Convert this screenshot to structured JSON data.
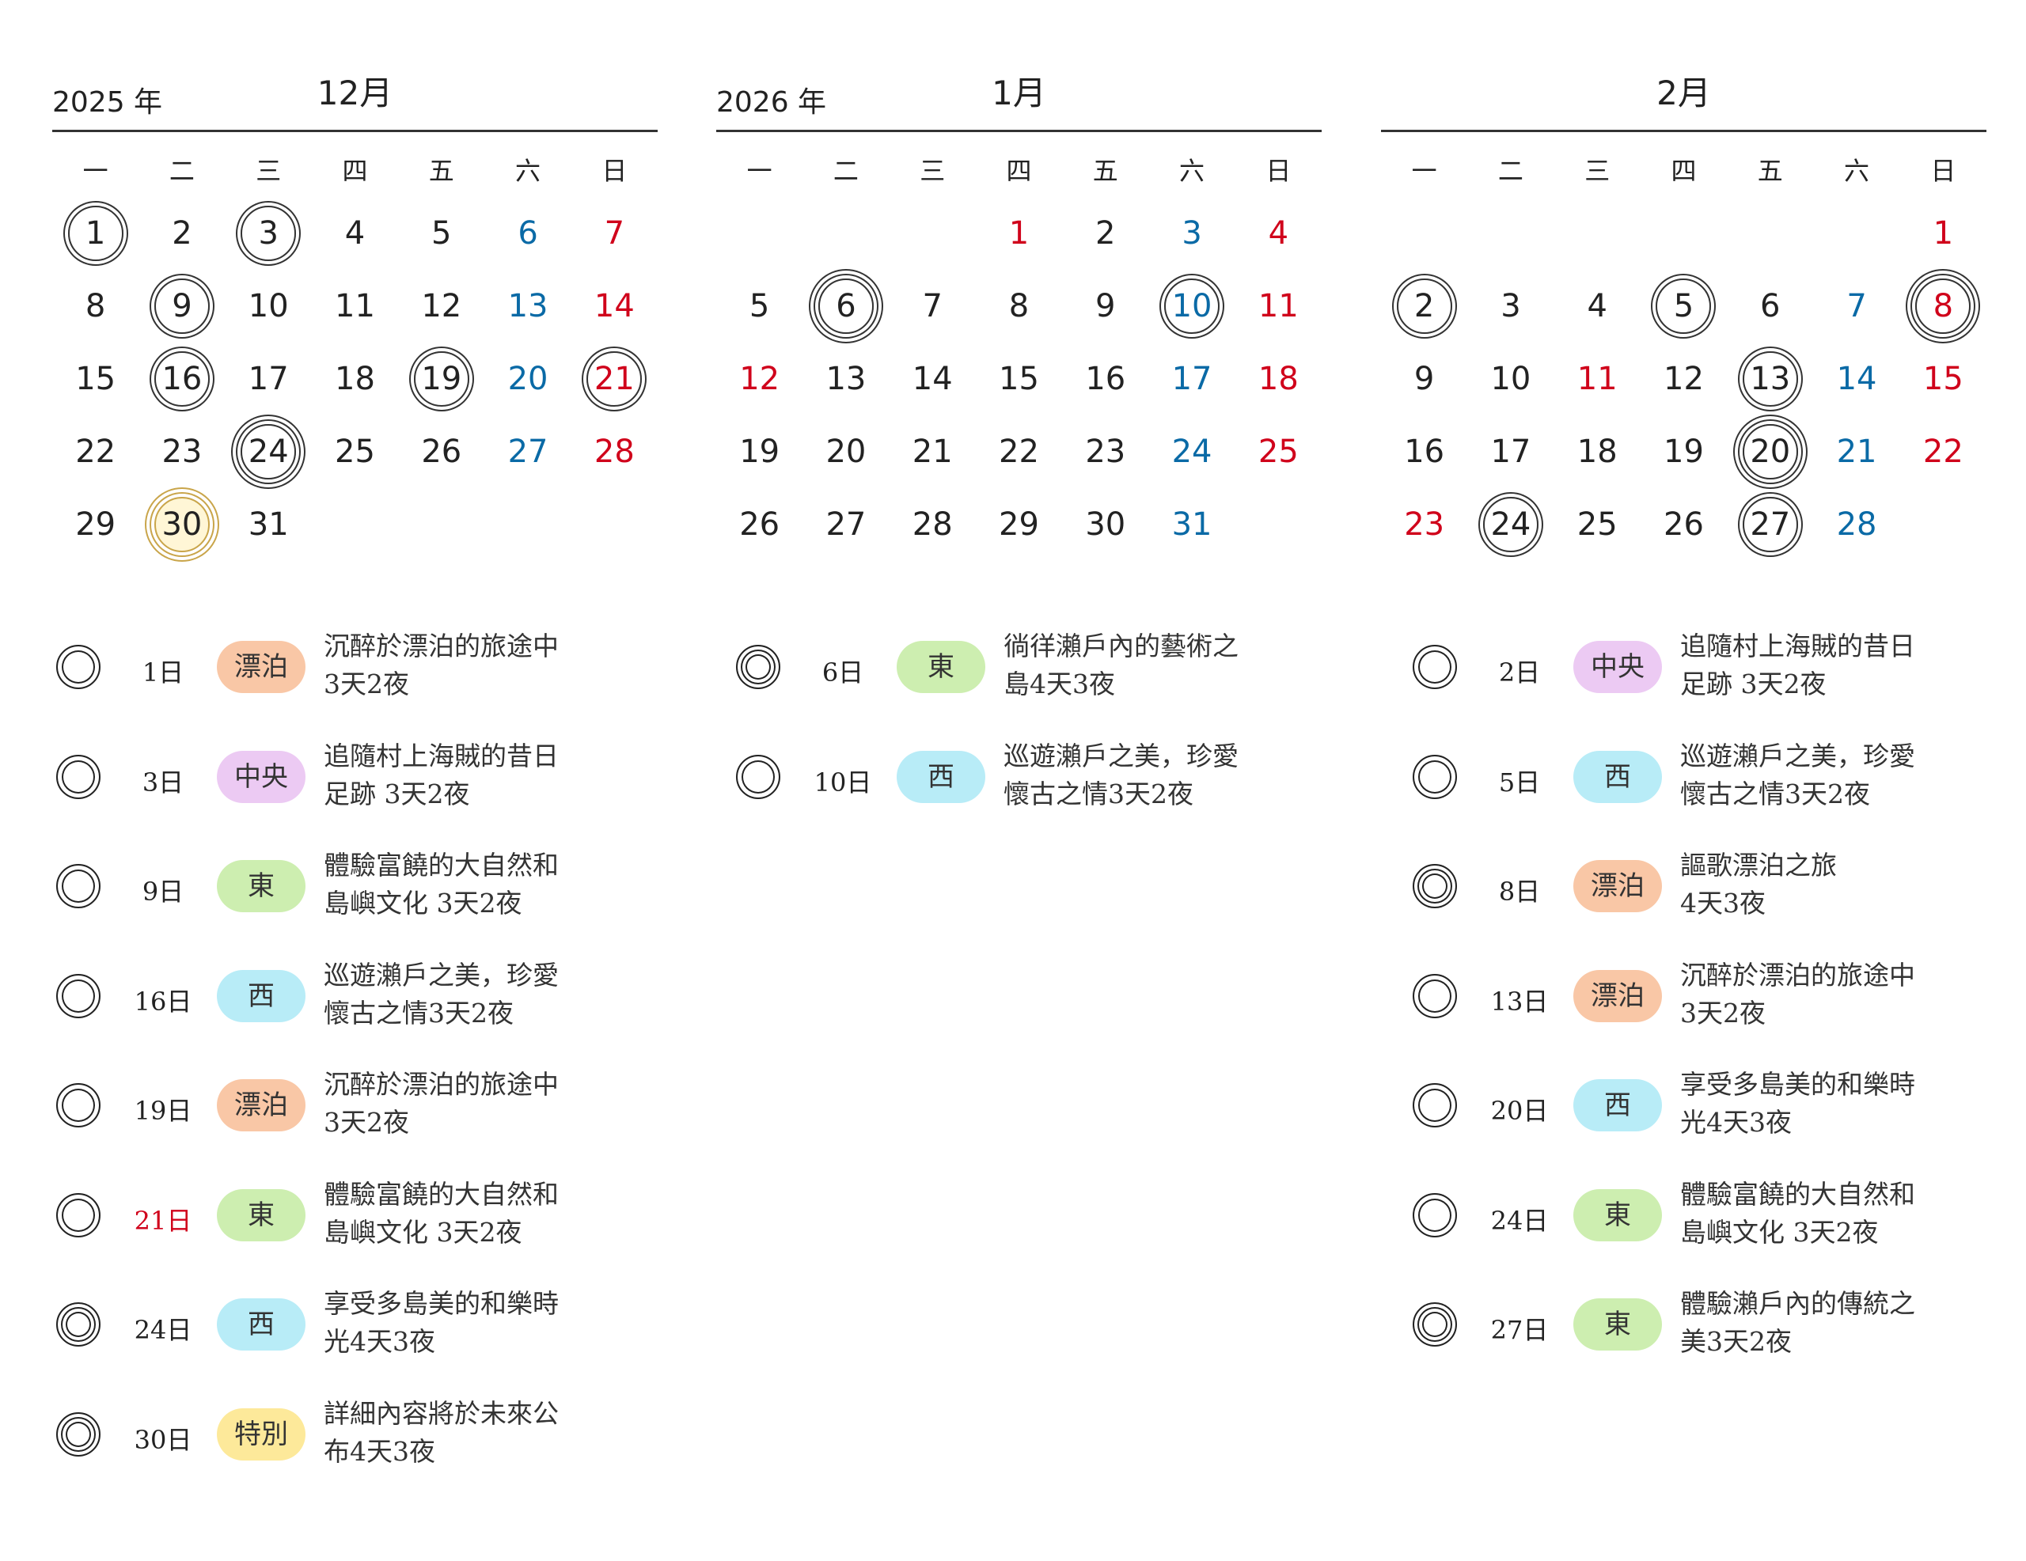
{
  "weekdays": [
    "一",
    "二",
    "三",
    "四",
    "五",
    "六",
    "日"
  ],
  "months": [
    {
      "year": "2025 年",
      "name": "12月",
      "offset": 0,
      "days": [
        {
          "d": "1",
          "c": "",
          "m": "single"
        },
        {
          "d": "2",
          "c": "",
          "m": ""
        },
        {
          "d": "3",
          "c": "",
          "m": "single"
        },
        {
          "d": "4",
          "c": "",
          "m": ""
        },
        {
          "d": "5",
          "c": "",
          "m": ""
        },
        {
          "d": "6",
          "c": "sat",
          "m": ""
        },
        {
          "d": "7",
          "c": "red",
          "m": ""
        },
        {
          "d": "8",
          "c": "",
          "m": ""
        },
        {
          "d": "9",
          "c": "",
          "m": "single"
        },
        {
          "d": "10",
          "c": "",
          "m": ""
        },
        {
          "d": "11",
          "c": "",
          "m": ""
        },
        {
          "d": "12",
          "c": "",
          "m": ""
        },
        {
          "d": "13",
          "c": "sat",
          "m": ""
        },
        {
          "d": "14",
          "c": "red",
          "m": ""
        },
        {
          "d": "15",
          "c": "",
          "m": ""
        },
        {
          "d": "16",
          "c": "",
          "m": "single"
        },
        {
          "d": "17",
          "c": "",
          "m": ""
        },
        {
          "d": "18",
          "c": "",
          "m": ""
        },
        {
          "d": "19",
          "c": "",
          "m": "single"
        },
        {
          "d": "20",
          "c": "sat",
          "m": ""
        },
        {
          "d": "21",
          "c": "red",
          "m": "single"
        },
        {
          "d": "22",
          "c": "",
          "m": ""
        },
        {
          "d": "23",
          "c": "",
          "m": ""
        },
        {
          "d": "24",
          "c": "",
          "m": "double"
        },
        {
          "d": "25",
          "c": "",
          "m": ""
        },
        {
          "d": "26",
          "c": "",
          "m": ""
        },
        {
          "d": "27",
          "c": "sat",
          "m": ""
        },
        {
          "d": "28",
          "c": "red",
          "m": ""
        },
        {
          "d": "29",
          "c": "",
          "m": ""
        },
        {
          "d": "30",
          "c": "",
          "m": "gold"
        },
        {
          "d": "31",
          "c": "",
          "m": ""
        }
      ]
    },
    {
      "year": "2026 年",
      "name": "1月",
      "offset": 3,
      "days": [
        {
          "d": "1",
          "c": "red",
          "m": ""
        },
        {
          "d": "2",
          "c": "",
          "m": ""
        },
        {
          "d": "3",
          "c": "sat",
          "m": ""
        },
        {
          "d": "4",
          "c": "red",
          "m": ""
        },
        {
          "d": "5",
          "c": "",
          "m": ""
        },
        {
          "d": "6",
          "c": "",
          "m": "double"
        },
        {
          "d": "7",
          "c": "",
          "m": ""
        },
        {
          "d": "8",
          "c": "",
          "m": ""
        },
        {
          "d": "9",
          "c": "",
          "m": ""
        },
        {
          "d": "10",
          "c": "sat",
          "m": "single"
        },
        {
          "d": "11",
          "c": "red",
          "m": ""
        },
        {
          "d": "12",
          "c": "red",
          "m": ""
        },
        {
          "d": "13",
          "c": "",
          "m": ""
        },
        {
          "d": "14",
          "c": "",
          "m": ""
        },
        {
          "d": "15",
          "c": "",
          "m": ""
        },
        {
          "d": "16",
          "c": "",
          "m": ""
        },
        {
          "d": "17",
          "c": "sat",
          "m": ""
        },
        {
          "d": "18",
          "c": "red",
          "m": ""
        },
        {
          "d": "19",
          "c": "",
          "m": ""
        },
        {
          "d": "20",
          "c": "",
          "m": ""
        },
        {
          "d": "21",
          "c": "",
          "m": ""
        },
        {
          "d": "22",
          "c": "",
          "m": ""
        },
        {
          "d": "23",
          "c": "",
          "m": ""
        },
        {
          "d": "24",
          "c": "sat",
          "m": ""
        },
        {
          "d": "25",
          "c": "red",
          "m": ""
        },
        {
          "d": "26",
          "c": "",
          "m": ""
        },
        {
          "d": "27",
          "c": "",
          "m": ""
        },
        {
          "d": "28",
          "c": "",
          "m": ""
        },
        {
          "d": "29",
          "c": "",
          "m": ""
        },
        {
          "d": "30",
          "c": "",
          "m": ""
        },
        {
          "d": "31",
          "c": "sat",
          "m": ""
        }
      ]
    },
    {
      "year": "",
      "name": "2月",
      "offset": 6,
      "days": [
        {
          "d": "1",
          "c": "red",
          "m": ""
        },
        {
          "d": "2",
          "c": "",
          "m": "single"
        },
        {
          "d": "3",
          "c": "",
          "m": ""
        },
        {
          "d": "4",
          "c": "",
          "m": ""
        },
        {
          "d": "5",
          "c": "",
          "m": "single"
        },
        {
          "d": "6",
          "c": "",
          "m": ""
        },
        {
          "d": "7",
          "c": "sat",
          "m": ""
        },
        {
          "d": "8",
          "c": "red",
          "m": "double"
        },
        {
          "d": "9",
          "c": "",
          "m": ""
        },
        {
          "d": "10",
          "c": "",
          "m": ""
        },
        {
          "d": "11",
          "c": "red",
          "m": ""
        },
        {
          "d": "12",
          "c": "",
          "m": ""
        },
        {
          "d": "13",
          "c": "",
          "m": "single"
        },
        {
          "d": "14",
          "c": "sat",
          "m": ""
        },
        {
          "d": "15",
          "c": "red",
          "m": ""
        },
        {
          "d": "16",
          "c": "",
          "m": ""
        },
        {
          "d": "17",
          "c": "",
          "m": ""
        },
        {
          "d": "18",
          "c": "",
          "m": ""
        },
        {
          "d": "19",
          "c": "",
          "m": ""
        },
        {
          "d": "20",
          "c": "",
          "m": "double"
        },
        {
          "d": "21",
          "c": "sat",
          "m": ""
        },
        {
          "d": "22",
          "c": "red",
          "m": ""
        },
        {
          "d": "23",
          "c": "red",
          "m": ""
        },
        {
          "d": "24",
          "c": "",
          "m": "single"
        },
        {
          "d": "25",
          "c": "",
          "m": ""
        },
        {
          "d": "26",
          "c": "",
          "m": ""
        },
        {
          "d": "27",
          "c": "",
          "m": "single"
        },
        {
          "d": "28",
          "c": "sat",
          "m": ""
        }
      ]
    }
  ],
  "tag_colors": {
    "漂泊": "#f9c7a6",
    "中央": "#eccaf3",
    "東": "#cdeeb0",
    "西": "#b8ecf7",
    "特別": "#fde99a"
  },
  "events": [
    [
      {
        "mark": "single",
        "date": "1日",
        "red": false,
        "tag": "漂泊",
        "text": "沉醉於漂泊的旅途中\n3天2夜"
      },
      {
        "mark": "single",
        "date": "3日",
        "red": false,
        "tag": "中央",
        "text": "追隨村上海賊的昔日\n足跡 3天2夜"
      },
      {
        "mark": "single",
        "date": "9日",
        "red": false,
        "tag": "東",
        "text": "體驗富饒的大自然和\n島嶼文化 3天2夜"
      },
      {
        "mark": "single",
        "date": "16日",
        "red": false,
        "tag": "西",
        "text": "巡遊瀨戶之美，珍愛\n懷古之情3天2夜"
      },
      {
        "mark": "single",
        "date": "19日",
        "red": false,
        "tag": "漂泊",
        "text": "沉醉於漂泊的旅途中\n3天2夜"
      },
      {
        "mark": "single",
        "date": "21日",
        "red": true,
        "tag": "東",
        "text": "體驗富饒的大自然和\n島嶼文化 3天2夜"
      },
      {
        "mark": "double",
        "date": "24日",
        "red": false,
        "tag": "西",
        "text": "享受多島美的和樂時\n光4天3夜"
      },
      {
        "mark": "double",
        "date": "30日",
        "red": false,
        "tag": "特別",
        "text": "詳細內容將於未來公\n布4天3夜"
      }
    ],
    [
      {
        "mark": "double",
        "date": "6日",
        "red": false,
        "tag": "東",
        "text": "徜徉瀨戶內的藝術之\n島4天3夜"
      },
      {
        "mark": "single",
        "date": "10日",
        "red": false,
        "tag": "西",
        "text": "巡遊瀨戶之美，珍愛\n懷古之情3天2夜"
      }
    ],
    [
      {
        "mark": "single",
        "date": "2日",
        "red": false,
        "tag": "中央",
        "text": "追隨村上海賊的昔日\n足跡 3天2夜"
      },
      {
        "mark": "single",
        "date": "5日",
        "red": false,
        "tag": "西",
        "text": "巡遊瀨戶之美，珍愛\n懷古之情3天2夜"
      },
      {
        "mark": "double",
        "date": "8日",
        "red": false,
        "tag": "漂泊",
        "text": "謳歌漂泊之旅\n4天3夜"
      },
      {
        "mark": "single",
        "date": "13日",
        "red": false,
        "tag": "漂泊",
        "text": "沉醉於漂泊的旅途中\n3天2夜"
      },
      {
        "mark": "single",
        "date": "20日",
        "red": false,
        "tag": "西",
        "text": "享受多島美的和樂時\n光4天3夜"
      },
      {
        "mark": "single",
        "date": "24日",
        "red": false,
        "tag": "東",
        "text": "體驗富饒的大自然和\n島嶼文化 3天2夜"
      },
      {
        "mark": "double",
        "date": "27日",
        "red": false,
        "tag": "東",
        "text": "體驗瀨戶內的傳統之\n美3天2夜"
      }
    ]
  ]
}
